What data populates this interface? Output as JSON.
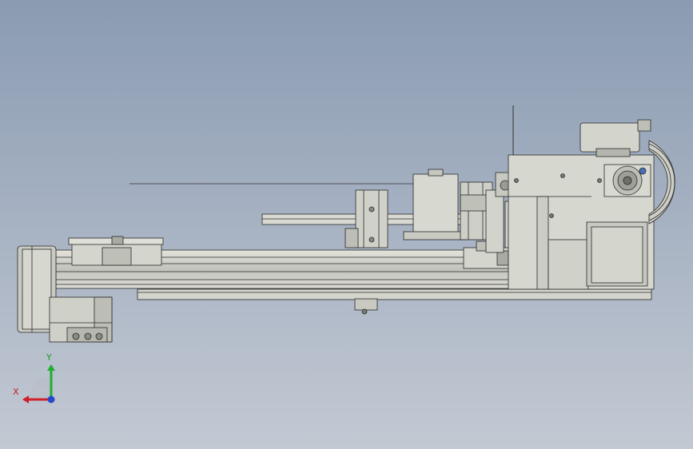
{
  "viewport": {
    "background_top": "#8a9bb2",
    "background_bottom": "#c3c9d3"
  },
  "model": {
    "part_fill": "#cfd0c8",
    "part_stroke": "#2a2a2a",
    "accent_blue": "#4a6fb8"
  },
  "triad": {
    "x_label": "X",
    "y_label": "Y",
    "x_color": "#d0202a",
    "y_color": "#1fae2f",
    "z_color": "#2848c8"
  }
}
